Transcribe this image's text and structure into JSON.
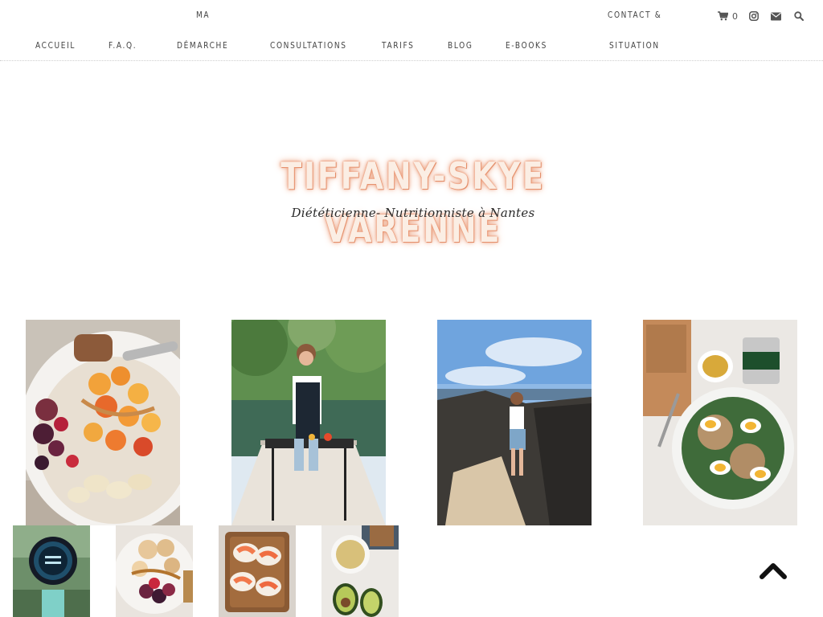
{
  "nav": {
    "items": [
      {
        "label": "ACCUEIL"
      },
      {
        "label": "F.A.Q."
      },
      {
        "label_top": "MA",
        "label": "DÉMARCHE"
      },
      {
        "label": "CONSULTATIONS"
      },
      {
        "label": "TARIFS"
      },
      {
        "label": "BLOG"
      },
      {
        "label": "E-BOOKS"
      },
      {
        "label_top": "CONTACT &",
        "label": "SITUATION"
      }
    ],
    "cart_count": "0",
    "icons": [
      "cart-icon",
      "instagram-icon",
      "envelope-icon",
      "search-icon"
    ]
  },
  "logo": {
    "title": "TIFFANY-SKYE VARENNE",
    "subtitle": "Diététicienne- Nutritionniste à Nantes"
  },
  "gallery": {
    "large": [
      "fruit-bowl-photo",
      "barbecue-photo",
      "seaside-photo",
      "egg-salad-photo"
    ],
    "small": [
      "smartwatch-photo",
      "berry-pancakes-photo",
      "salmon-toast-photo",
      "avocado-dip-photo"
    ]
  },
  "colors": {
    "nav_text": "#444444",
    "logo_glow": "#e8875f",
    "background": "#ffffff"
  }
}
